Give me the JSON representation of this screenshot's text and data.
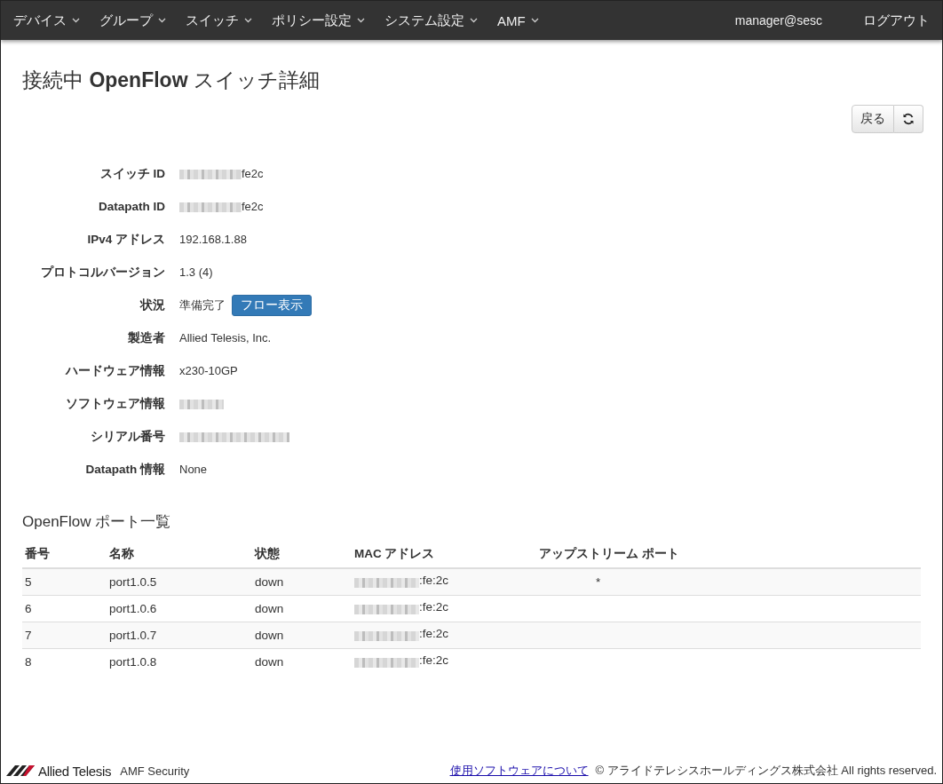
{
  "navbar": {
    "menus": [
      {
        "label": "デバイス"
      },
      {
        "label": "グループ"
      },
      {
        "label": "スイッチ"
      },
      {
        "label": "ポリシー設定"
      },
      {
        "label": "システム設定"
      },
      {
        "label": "AMF"
      }
    ],
    "user": "manager@sesc",
    "logout": "ログアウト"
  },
  "page": {
    "title": "接続中 **OpenFlow** スイッチ詳細",
    "back_button": "戻る"
  },
  "details": [
    {
      "label": "スイッチ ID",
      "kind": "masked",
      "value": "fe2c"
    },
    {
      "label": "Datapath ID",
      "kind": "masked",
      "value": "fe2c"
    },
    {
      "label": "IPv4 アドレス",
      "value": "192.168.1.88"
    },
    {
      "label": "プロトコルバージョン",
      "value": "1.3 (4)"
    },
    {
      "label": "状況",
      "value": "準備完了",
      "button": "フロー表示"
    },
    {
      "label": "製造者",
      "value": "Allied Telesis, Inc."
    },
    {
      "label": "ハードウェア情報",
      "value": "x230-10GP"
    },
    {
      "label": "ソフトウェア情報",
      "kind": "version"
    },
    {
      "label": "シリアル番号",
      "kind": "serial"
    },
    {
      "label": "Datapath 情報",
      "value": "None"
    }
  ],
  "ports": {
    "title": "OpenFlow ポート一覧",
    "columns": [
      "番号",
      "名称",
      "状態",
      "MAC アドレス",
      "アップストリーム ポート"
    ],
    "rows": [
      {
        "number": "5",
        "name": "port1.0.5",
        "state": "down",
        "mac": ":fe:2c",
        "upstream": "*"
      },
      {
        "number": "6",
        "name": "port1.0.6",
        "state": "down",
        "mac": ":fe:2c"
      },
      {
        "number": "7",
        "name": "port1.0.7",
        "state": "down",
        "mac": ":fe:2c"
      },
      {
        "number": "8",
        "name": "port1.0.8",
        "state": "down",
        "mac": ":fe:2c"
      }
    ]
  },
  "footer": {
    "logo": "Allied Telesis",
    "product": "AMF Security",
    "link": "使用ソフトウェアについて",
    "copyright": "© アライドテレシスホールディングス株式会社 All rights reserved."
  }
}
